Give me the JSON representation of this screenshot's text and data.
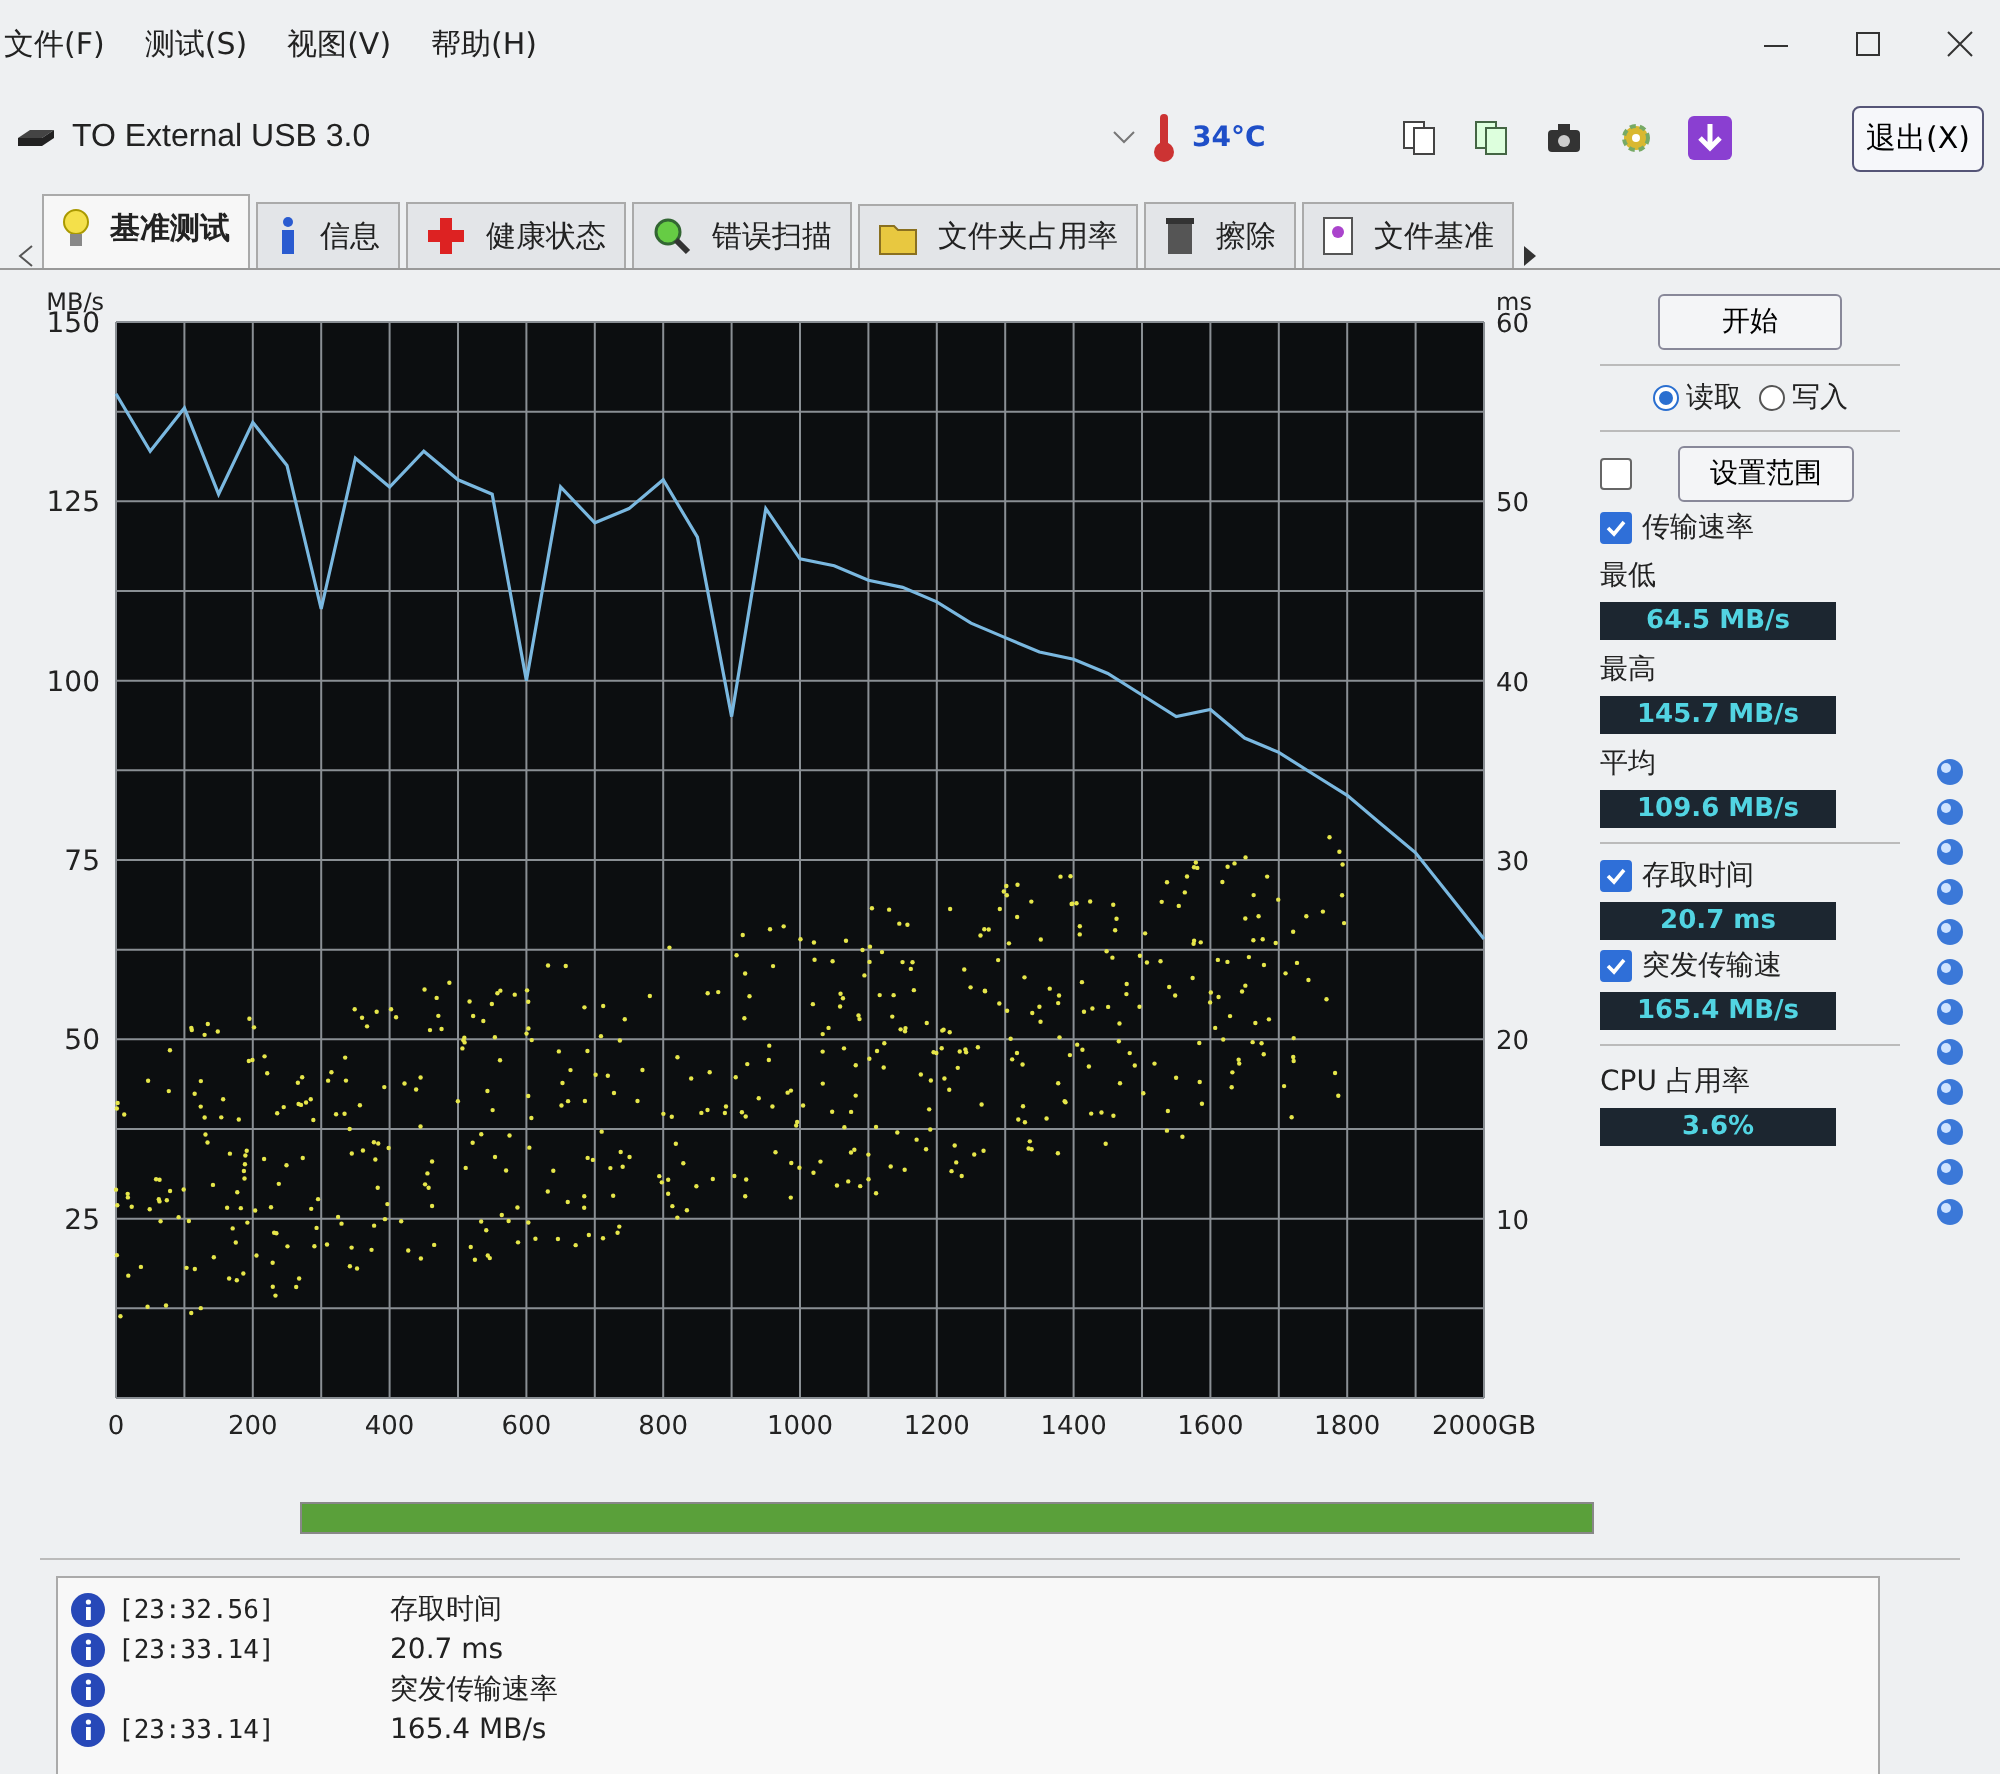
{
  "menu": [
    "文件(F)",
    "测试(S)",
    "视图(V)",
    "帮助(H)"
  ],
  "drive": {
    "name": "TO External USB 3.0"
  },
  "temperature": "34°C",
  "exit_button": "退出(X)",
  "tabs": [
    {
      "label": "基准测试",
      "kind": "bulb",
      "selected": true
    },
    {
      "label": "信息",
      "kind": "info",
      "selected": false
    },
    {
      "label": "健康状态",
      "kind": "cross",
      "selected": false
    },
    {
      "label": "错误扫描",
      "kind": "magnifier",
      "selected": false
    },
    {
      "label": "文件夹占用率",
      "kind": "folder",
      "selected": false
    },
    {
      "label": "擦除",
      "kind": "trash",
      "selected": false
    },
    {
      "label": "文件基准",
      "kind": "document",
      "selected": false
    }
  ],
  "chart": {
    "chart_data": {
      "type": "line",
      "ylabel": "MB/s",
      "x": [
        0,
        50,
        100,
        150,
        200,
        250,
        300,
        350,
        400,
        450,
        500,
        550,
        600,
        650,
        700,
        750,
        800,
        850,
        900,
        950,
        1000,
        1050,
        1100,
        1150,
        1200,
        1250,
        1300,
        1350,
        1400,
        1450,
        1500,
        1550,
        1600,
        1650,
        1700,
        1750,
        1800,
        1850,
        1900,
        1950,
        2000
      ],
      "grid": true,
      "series": [
        {
          "color": "#7ab8e0",
          "values": [
            140,
            132,
            138,
            126,
            136,
            130,
            110,
            131,
            127,
            132,
            128,
            126,
            100,
            127,
            122,
            124,
            128,
            120,
            95,
            124,
            117,
            116,
            114,
            113,
            111,
            108,
            106,
            104,
            103,
            101,
            98,
            95,
            96,
            92,
            90,
            87,
            84,
            80,
            76,
            70,
            64
          ]
        }
      ],
      "xlim": [
        0,
        2000
      ],
      "ylim": [
        0,
        150
      ],
      "xticks": [
        0,
        200,
        400,
        600,
        800,
        1000,
        1200,
        1400,
        1600,
        1800,
        {
          "value": 2000,
          "label": "2000GB"
        }
      ],
      "yticks": [
        25,
        50,
        75,
        100,
        125,
        150
      ]
    },
    "right_axis": {
      "label": "ms",
      "ticks": [
        "60",
        "50",
        "40",
        "30",
        "20",
        "10"
      ]
    }
  },
  "panel": {
    "start_button": "开始",
    "modes": [
      {
        "label": "读取",
        "selected": true
      },
      {
        "label": "写入",
        "selected": false
      }
    ],
    "range": {
      "checked": false,
      "button": "设置范围"
    },
    "transfer": {
      "label": "传输速率",
      "checked": true
    },
    "stats": [
      {
        "label": "最低",
        "value": "64.5 MB/s"
      },
      {
        "label": "最高",
        "value": "145.7 MB/s"
      },
      {
        "label": "平均",
        "value": "109.6 MB/s"
      }
    ],
    "access": {
      "label": "存取时间",
      "checked": true,
      "value": "20.7 ms"
    },
    "burst": {
      "label": "突发传输速",
      "checked": true,
      "value": "165.4 MB/s"
    },
    "cpu": {
      "label": "CPU 占用率",
      "value": "3.6%"
    }
  },
  "progress": {
    "level": 1
  },
  "log": [
    {
      "time": "[23:32.56]",
      "message": "存取时间"
    },
    {
      "time": "[23:33.14]",
      "message": "20.7 ms"
    },
    {
      "message": "突发传输速率"
    },
    {
      "time": "[23:33.14]",
      "message": "165.4 MB/s"
    }
  ]
}
